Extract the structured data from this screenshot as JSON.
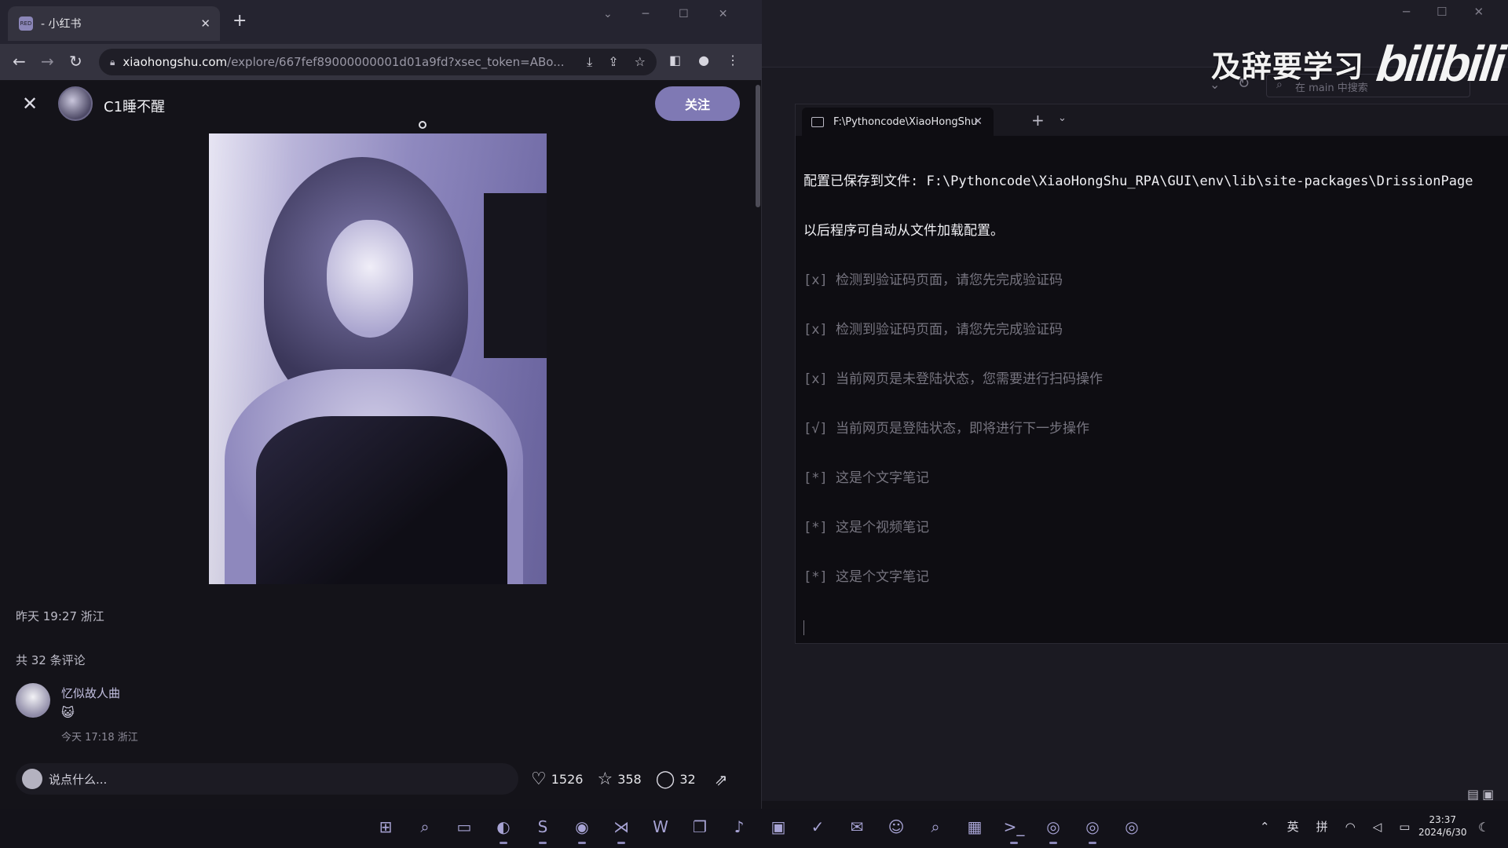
{
  "browser": {
    "tab_title": "- 小红书",
    "new_tab_icon": "plus-icon",
    "url_host": "xiaohongshu.com",
    "url_path": "/explore/667fef89000000001d01a9fd?xsec_token=ABo..."
  },
  "note": {
    "author": "C1睡不醒",
    "follow_label": "关注",
    "meta": "昨天 19:27 浙江",
    "comment_count_label": "共 32 条评论",
    "comment": {
      "user": "忆似故人曲",
      "emoji": "😺",
      "time": "今天 17:18 浙江"
    },
    "input_placeholder": "说点什么...",
    "likes": "1526",
    "collects": "358",
    "comments": "32"
  },
  "bg_app": {
    "search_placeholder": "在 main 中搜索",
    "watermark_text": "及辞要学习",
    "watermark_logo": "bilibili"
  },
  "terminal": {
    "tab_title": "F:\\Pythoncode\\XiaoHongShu",
    "lines": [
      "配置已保存到文件: F:\\Pythoncode\\XiaoHongShu_RPA\\GUI\\env\\lib\\site-packages\\DrissionPage",
      "以后程序可自动从文件加载配置。",
      "[x] 检测到验证码页面，请您先完成验证码",
      "[x] 检测到验证码页面，请您先完成验证码",
      "[x] 当前网页是未登陆状态，您需要进行扫码操作",
      "[√] 当前网页是登陆状态，即将进行下一步操作",
      "[*] 这是个文字笔记",
      "[*] 这是个视频笔记",
      "[*] 这是个文字笔记"
    ]
  },
  "taskbar": {
    "lang": "英",
    "ime": "拼",
    "time": "23:37",
    "date": "2024/6/30"
  }
}
